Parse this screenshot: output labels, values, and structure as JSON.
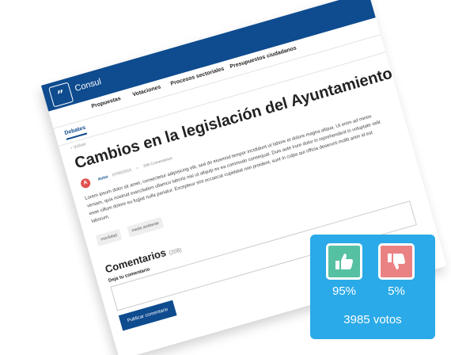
{
  "app": {
    "brand": "Consul"
  },
  "nav": {
    "items": [
      "Propuestas",
      "Votaciones",
      "Procesos sectoriales",
      "Presupuestos ciudadanos"
    ]
  },
  "tabs": {
    "active": "Debates"
  },
  "article": {
    "back": "‹ Volver",
    "title": "Cambios en la legislación del Ayuntamiento",
    "avatar_letter": "A",
    "author": "Autor",
    "date": "07/05/2015",
    "comments_count": "208 Comentarios",
    "body": "Lorem ipsum dolor sit amet, consectetur adipisicing elit, sed do eiusmod tempor incididunt ut labore et dolore magna aliqua. Ut enim ad minim veniam, quis nostrud exercitation ullamco laboris nisi ut aliquip ex ea commodo consequat. Duis aute irure dolor in reprehenderit in voluptate velit esse cillum dolore eu fugiat nulla pariatur. Excepteur sint occaecat cupidatat non proident, sunt in culpa qui officia deserunt mollit anim id est laborum.",
    "tags": [
      "movilidad",
      "medio ambiente"
    ]
  },
  "comments": {
    "title": "Comentarios",
    "count": "(208)",
    "field_label": "Deja tu comentario",
    "publish_label": "Publicar comentario"
  },
  "vote": {
    "up_percent": "95%",
    "down_percent": "5%",
    "total": "3985 votos",
    "colors": {
      "panel": "#2aaae8",
      "up": "#55c0a2",
      "down": "#ea8283"
    }
  }
}
